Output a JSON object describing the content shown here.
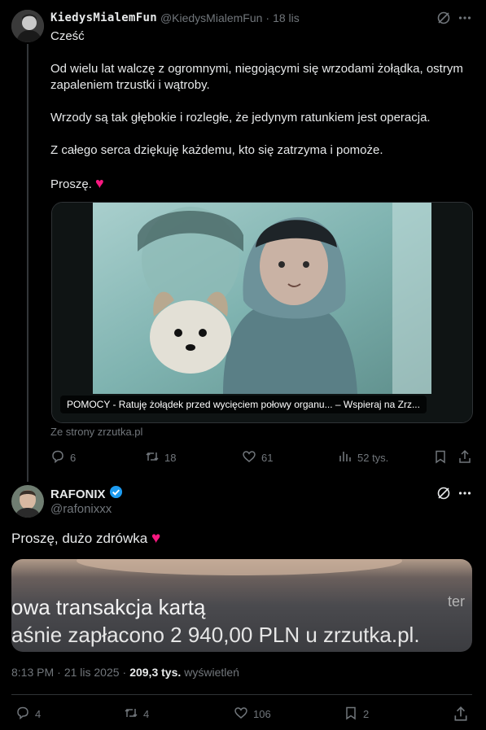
{
  "post1": {
    "display_name": "KiedysMialemFun",
    "handle": "@KiedysMialemFun",
    "dot": "·",
    "date": "18 lis",
    "paragraphs": [
      "Cześć",
      "Od wielu lat walczę z ogromnymi, niegojącymi się wrzodami żołądka, ostrym zapaleniem trzustki i wątroby.",
      "Wrzody są tak głębokie i rozległe, że jedynym ratunkiem jest operacja.",
      "Z całego serca dziękuję każdemu, kto się zatrzyma i pomoże.",
      "Proszę."
    ],
    "heart_emoji": "♥",
    "link_card": {
      "title": "POMOCY - Ratuję żołądek przed wycięciem połowy organu... – Wspieraj na Zrz...",
      "source": "Ze strony zrzutka.pl"
    },
    "actions": {
      "replies": "6",
      "reposts": "18",
      "likes": "61",
      "views": "52 tys."
    }
  },
  "post2": {
    "display_name": "RAFONIX",
    "handle": "@rafonixxx",
    "text": "Proszę, dużo zdrówka",
    "heart_emoji": "♥",
    "image_text": {
      "line1": "owa transakcja kartą",
      "line2": "aśnie zapłacono 2 940,00 PLN u zrzutka.pl.",
      "corner": "ter"
    },
    "meta": {
      "time": "8:13 PM",
      "dot": "·",
      "date": "21 lis 2025",
      "dot2": "·",
      "views_count": "209,3 tys.",
      "views_label": "wyświetleń"
    },
    "actions": {
      "replies": "4",
      "reposts": "4",
      "likes": "106",
      "bookmarks": "2"
    }
  },
  "colors": {
    "background": "#000000",
    "text": "#e7e9ea",
    "muted": "#71767b",
    "verified": "#1d9bf0",
    "heart": "#f91880",
    "divider": "#2f3336"
  },
  "icons": [
    "grok-icon",
    "more-icon",
    "reply-icon",
    "repost-icon",
    "like-icon",
    "views-icon",
    "bookmark-icon",
    "share-icon",
    "verified-icon"
  ]
}
